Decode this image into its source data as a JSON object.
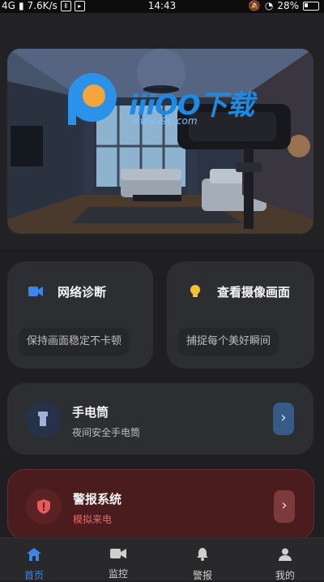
{
  "status_bar": {
    "network": "4G",
    "speed": "7.6K/s",
    "time": "14:43",
    "battery": "28%"
  },
  "banner": {
    "watermark_text": "iiiOO下载",
    "watermark_url": "www.i9p.com"
  },
  "cards": {
    "network_diagnosis": {
      "title": "网络诊断",
      "subtitle": "保持画面稳定不卡顿"
    },
    "view_camera": {
      "title": "查看摄像画面",
      "subtitle": "捕捉每个美好瞬间"
    },
    "flashlight": {
      "title": "手电筒",
      "subtitle": "夜间安全手电筒"
    },
    "alarm": {
      "title": "警报系统",
      "subtitle": "模拟来电"
    }
  },
  "tabs": [
    {
      "label": "首页",
      "icon": "home-icon",
      "active": true
    },
    {
      "label": "监控",
      "icon": "video-icon",
      "active": false
    },
    {
      "label": "警报",
      "icon": "bell-icon",
      "active": false
    },
    {
      "label": "我的",
      "icon": "user-icon",
      "active": false
    }
  ],
  "colors": {
    "accent": "#3b86e6",
    "card": "#2d2e31",
    "alarm_card": "#4a1c1e",
    "alarm_text": "#e46a6a"
  }
}
